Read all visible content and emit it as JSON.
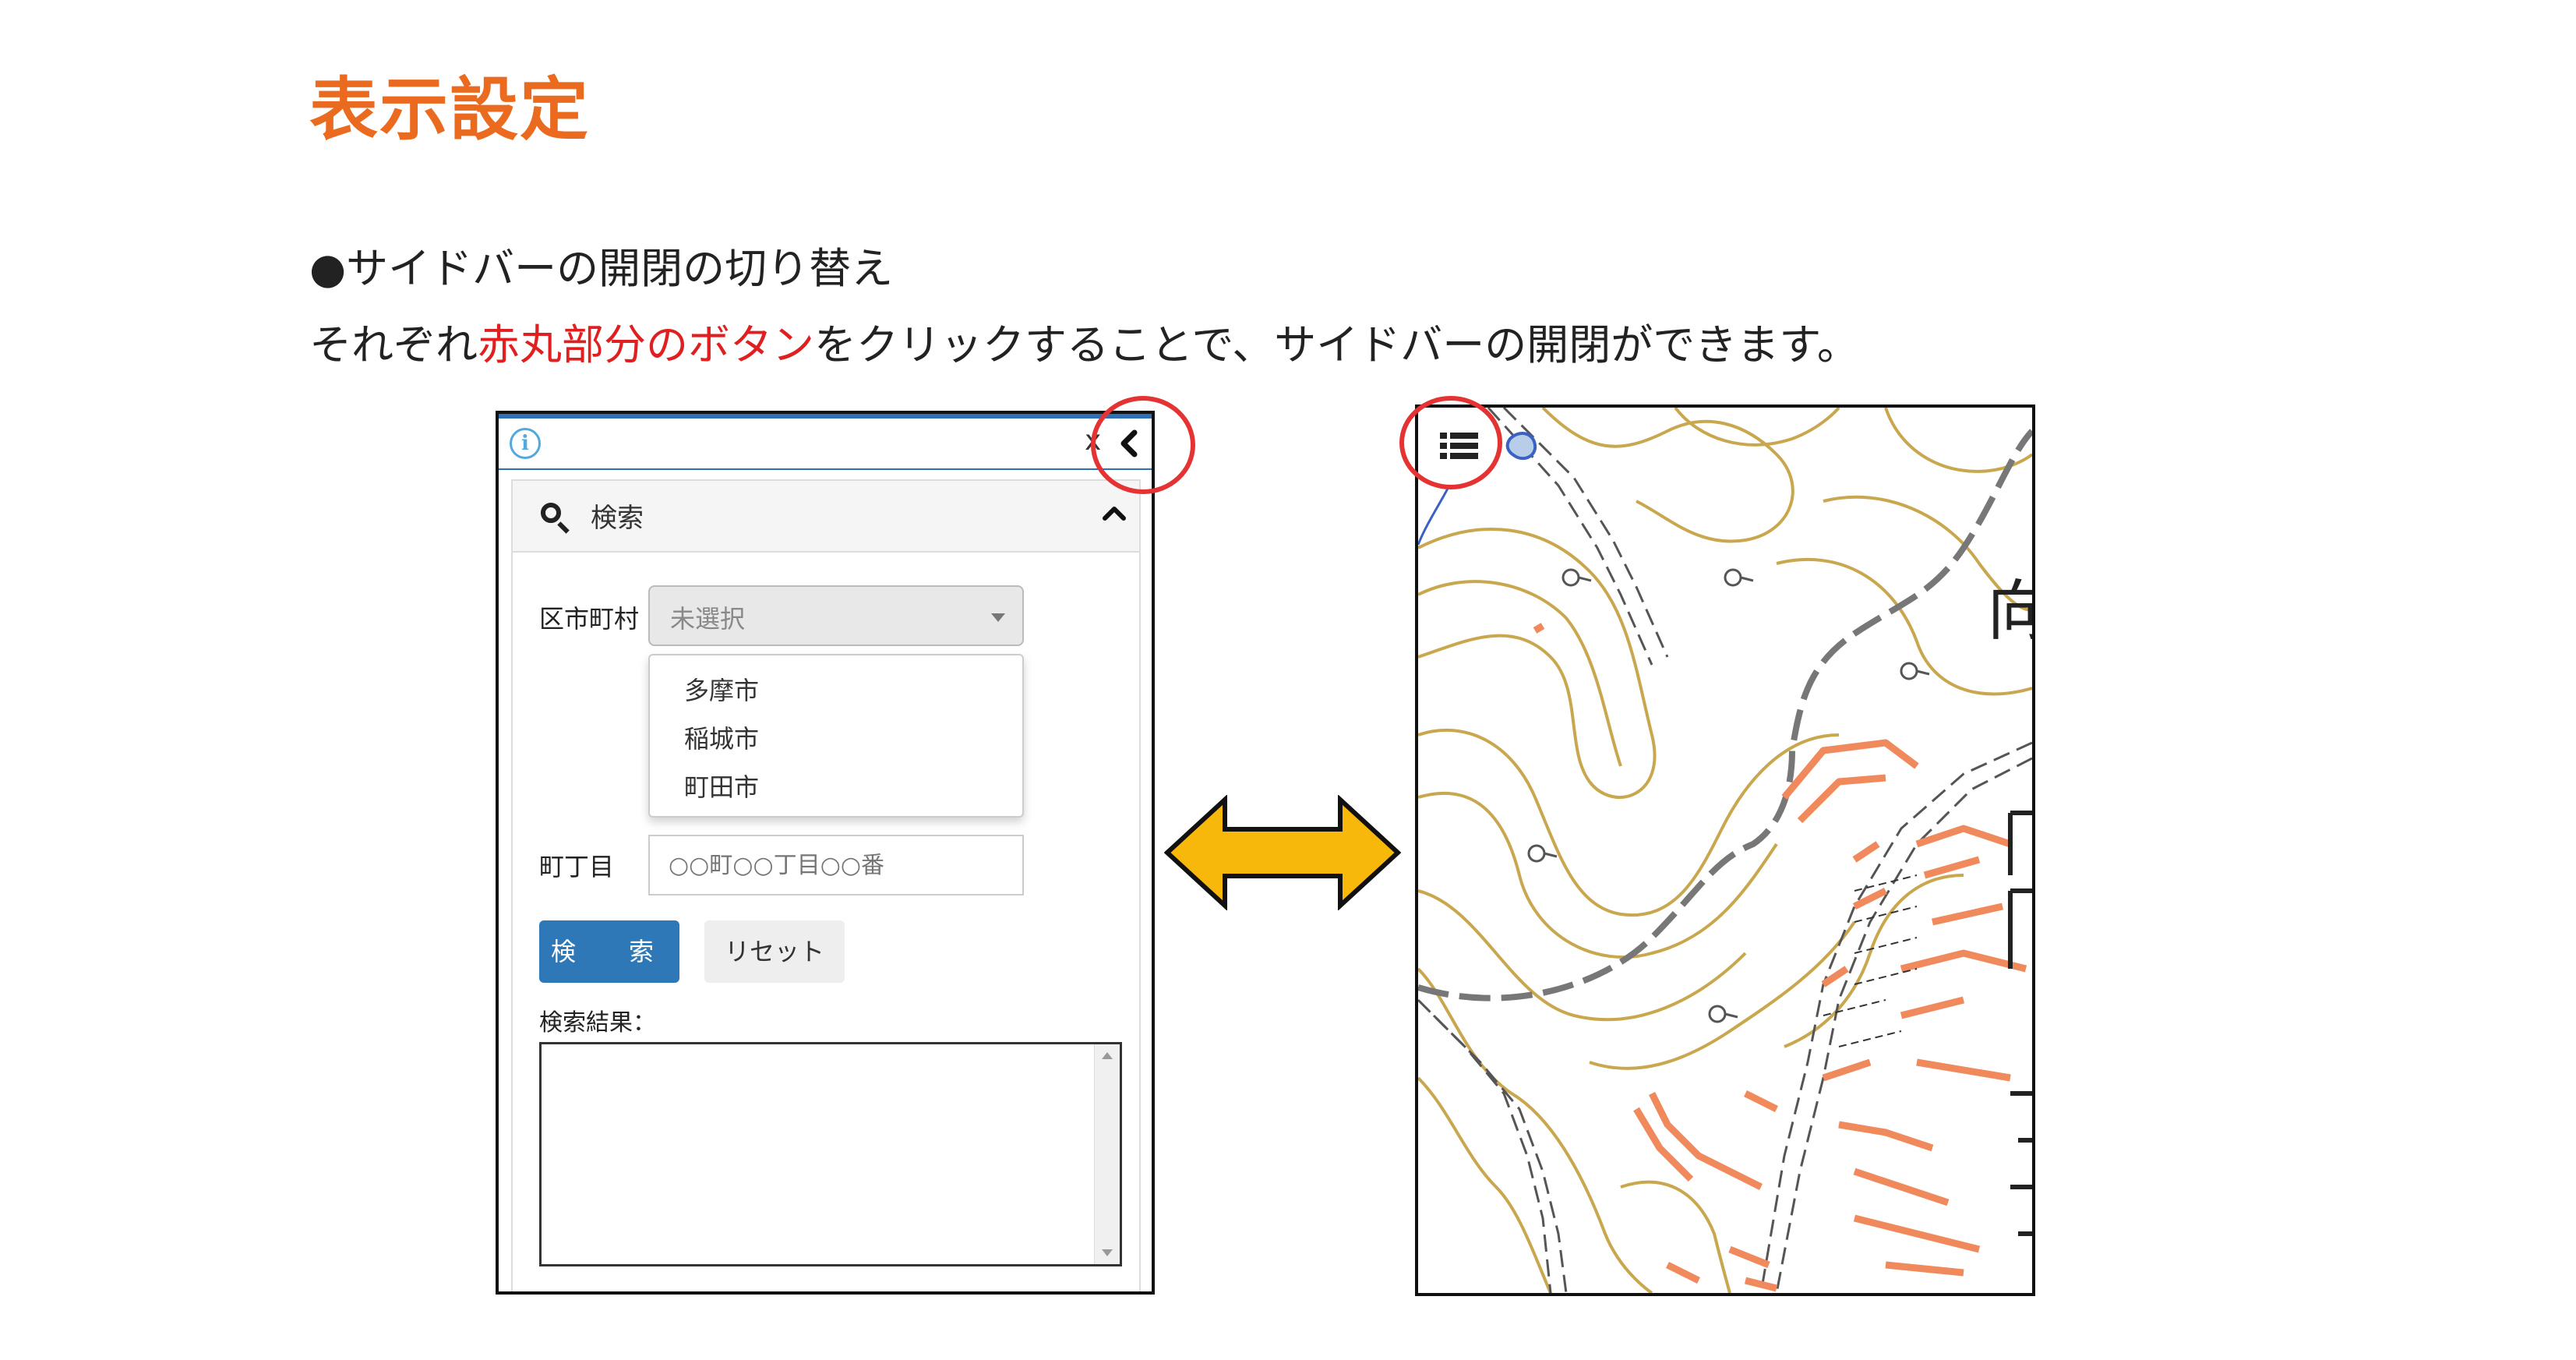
{
  "heading": "表示設定",
  "section_title": "●サイドバーの開閉の切り替え",
  "description": {
    "prefix": "それぞれ",
    "highlight": "赤丸部分のボタン",
    "suffix": "をクリックすることで、サイドバーの開閉ができます。"
  },
  "sidebar": {
    "info_icon_glyph": "i",
    "close_glyph": "x",
    "collapse_glyph": "‹",
    "search_header": "検索",
    "ward_label": "区市町村",
    "ward_selected": "未選択",
    "ward_options": [
      "多摩市",
      "稲城市",
      "町田市"
    ],
    "chome_label": "町丁目",
    "chome_placeholder": "○○町○○丁目○○番",
    "search_button": "検　索",
    "reset_button": "リセット",
    "results_label": "検索結果："
  },
  "map": {
    "partial_label_1": "向",
    "icon": "list-icon"
  },
  "colors": {
    "heading": "#ea6b1f",
    "highlight": "#e02020",
    "accent_blue": "#2f78b7",
    "arrow_fill": "#f7b80b",
    "contour": "#c9a74f",
    "building": "#f08a5d"
  }
}
